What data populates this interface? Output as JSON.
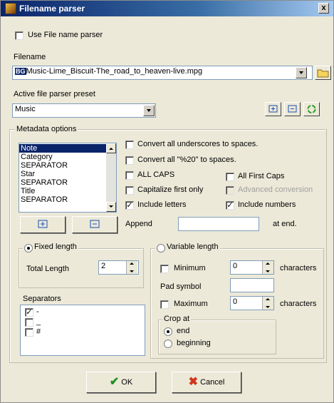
{
  "window": {
    "title": "Filename parser",
    "close_label": "x"
  },
  "use_parser": {
    "label": "Use File name parser",
    "checked": false
  },
  "filename": {
    "label": "Filename",
    "value": "Music-Lime_Biscuit-The_road_to_heaven-live.mpg",
    "badge": "BG"
  },
  "preset": {
    "label": "Active file parser preset",
    "value": "Music"
  },
  "metadata": {
    "legend": "Metadata options",
    "list": [
      "Note",
      "Category",
      "SEPARATOR",
      "Star",
      "SEPARATOR",
      "Title",
      "SEPARATOR"
    ],
    "options": {
      "underscores": {
        "label": "Convert all underscores to spaces.",
        "checked": false
      },
      "percent20": {
        "label": "Convert all \"%20\" to spaces.",
        "checked": false
      },
      "all_caps": {
        "label": "ALL CAPS",
        "checked": false
      },
      "capitalize_first": {
        "label": "Capitalize first only",
        "checked": false
      },
      "include_letters": {
        "label": "Include letters",
        "checked": true
      },
      "all_first_caps": {
        "label": "All First Caps",
        "checked": false
      },
      "advanced_conversion": {
        "label": "Advanced conversion",
        "checked": false,
        "disabled": true
      },
      "include_numbers": {
        "label": "Include numbers",
        "checked": true
      }
    },
    "append_label": "Append",
    "append_value": "",
    "at_end_label": "at end."
  },
  "fixed_length": {
    "label": "Fixed length",
    "selected": true,
    "total_label": "Total Length",
    "total_value": "2"
  },
  "separators": {
    "label": "Separators",
    "items": [
      {
        "text": "-",
        "checked": true
      },
      {
        "text": "_",
        "checked": false
      },
      {
        "text": "#",
        "checked": false
      }
    ]
  },
  "variable_length": {
    "label": "Variable length",
    "selected": false,
    "minimum_label": "Minimum",
    "minimum_value": "0",
    "characters_label": "characters",
    "pad_label": "Pad symbol",
    "pad_value": "",
    "maximum_label": "Maximum",
    "maximum_value": "0"
  },
  "crop": {
    "label": "Crop at",
    "end_label": "end",
    "beginning_label": "beginning",
    "selected": "end"
  },
  "buttons": {
    "ok": "OK",
    "cancel": "Cancel"
  }
}
